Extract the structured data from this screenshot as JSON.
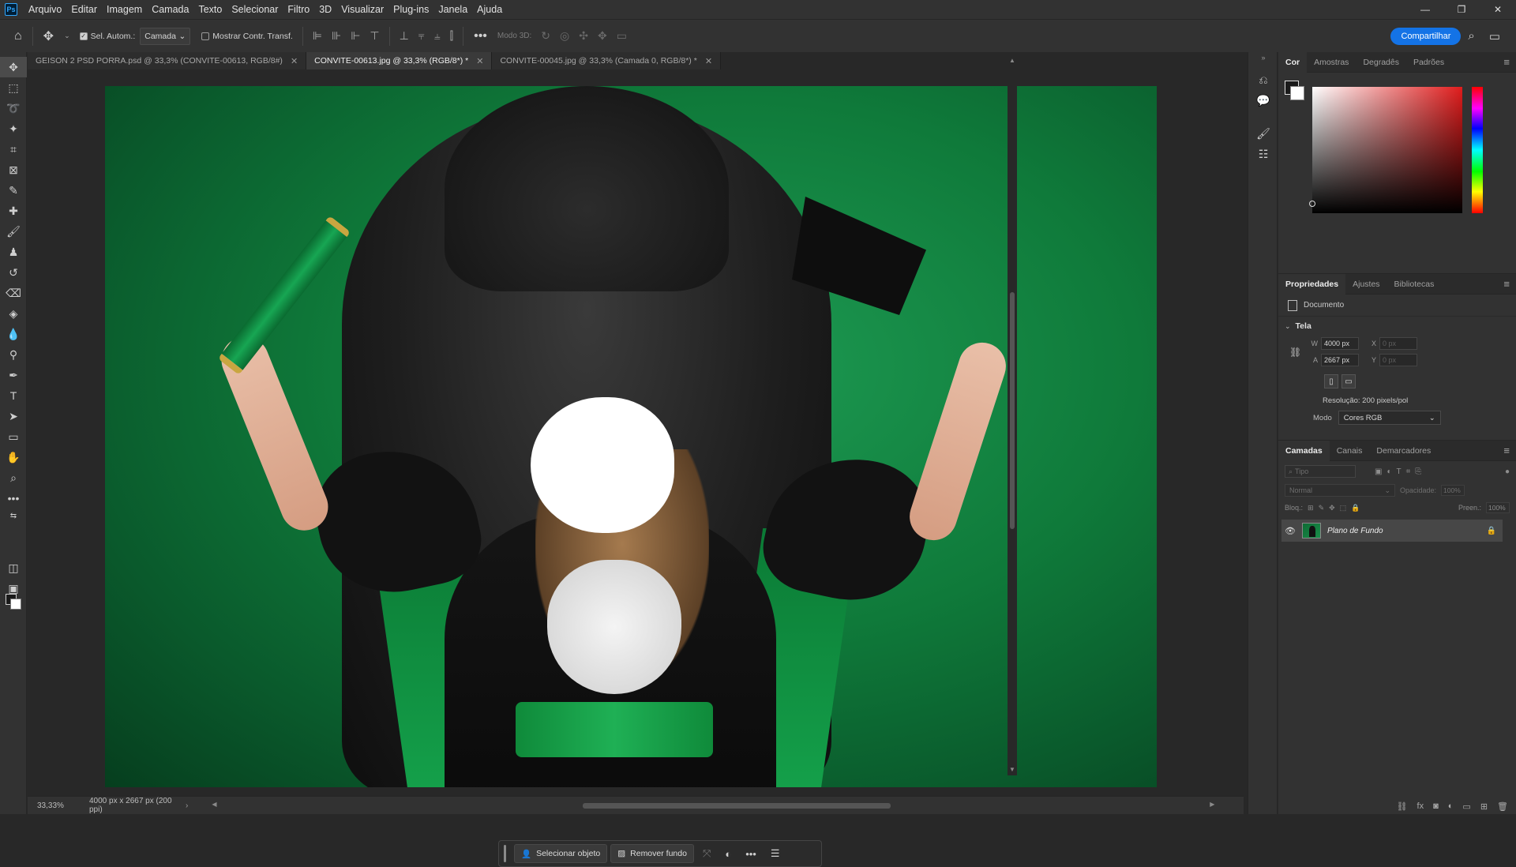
{
  "app": {
    "logo": "Ps"
  },
  "menu": [
    "Arquivo",
    "Editar",
    "Imagem",
    "Camada",
    "Texto",
    "Selecionar",
    "Filtro",
    "3D",
    "Visualizar",
    "Plug-ins",
    "Janela",
    "Ajuda"
  ],
  "window_controls": {
    "minimize": "—",
    "restore": "❐",
    "close": "✕"
  },
  "options": {
    "auto_select_label": "Sel. Autom.:",
    "auto_select_checked": true,
    "auto_select_target": "Camada",
    "show_transform_label": "Mostrar Contr. Transf.",
    "show_transform_checked": false,
    "mode_3d_label": "Modo 3D:",
    "share_label": "Compartilhar"
  },
  "tabs": [
    {
      "title": "GEISON 2 PSD PORRA.psd @ 33,3% (CONVITE-00613, RGB/8#)",
      "active": false
    },
    {
      "title": "CONVITE-00613.jpg @ 33,3% (RGB/8*) *",
      "active": true
    },
    {
      "title": "CONVITE-00045.jpg @ 33,3% (Camada 0, RGB/8*) *",
      "active": false
    }
  ],
  "contextbar": {
    "select_object": "Selecionar objeto",
    "remove_background": "Remover fundo"
  },
  "status": {
    "zoom": "33,33%",
    "doc_info": "4000 px x 2667 px (200 ppi)"
  },
  "color_panel": {
    "tabs": [
      "Cor",
      "Amostras",
      "Degradês",
      "Padrões"
    ],
    "active_tab": "Cor",
    "foreground": "#1a1a1a",
    "background": "#ffffff",
    "hue_color": "#e01c1c"
  },
  "properties_panel": {
    "tabs": [
      "Propriedades",
      "Ajustes",
      "Bibliotecas"
    ],
    "active_tab": "Propriedades",
    "doc_label": "Documento",
    "section": "Tela",
    "width_label": "W",
    "width_value": "4000 px",
    "height_label": "A",
    "height_value": "2667 px",
    "x_label": "X",
    "x_placeholder": "0 px",
    "y_label": "Y",
    "y_placeholder": "0 px",
    "resolution": "Resolução: 200 pixels/pol",
    "mode_label": "Modo",
    "mode_value": "Cores RGB"
  },
  "layers_panel": {
    "tabs": [
      "Camadas",
      "Canais",
      "Demarcadores"
    ],
    "active_tab": "Camadas",
    "filter_placeholder": "Tipo",
    "blend_mode": "Normal",
    "opacity_label": "Opacidade:",
    "opacity_value": "100%",
    "lock_label": "Bloq.:",
    "fill_label": "Preen.:",
    "fill_value": "100%",
    "layers": [
      {
        "name": "Plano de Fundo",
        "visible": true,
        "locked": true
      }
    ]
  }
}
